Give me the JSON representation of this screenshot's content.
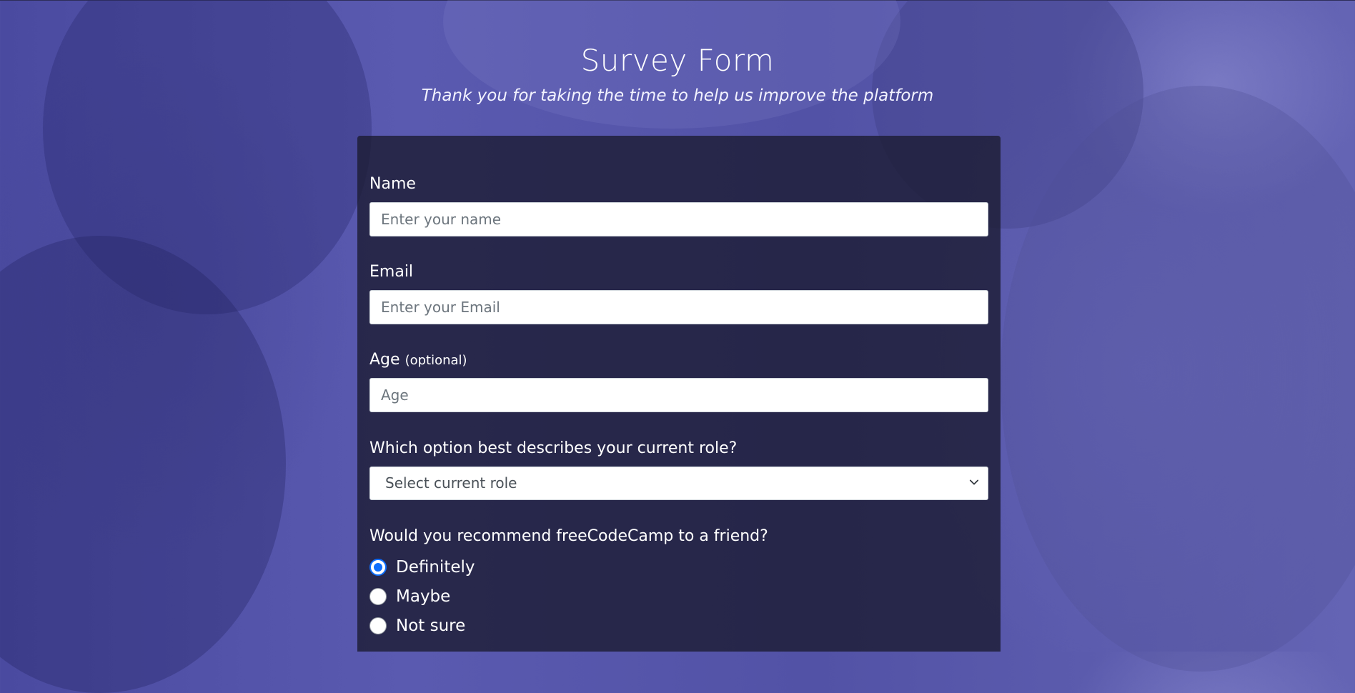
{
  "header": {
    "title": "Survey Form",
    "subtitle": "Thank you for taking the time to help us improve the platform"
  },
  "form": {
    "name": {
      "label": "Name",
      "placeholder": "Enter your name",
      "value": ""
    },
    "email": {
      "label": "Email",
      "placeholder": "Enter your Email",
      "value": ""
    },
    "age": {
      "label": "Age",
      "label_note": "(optional)",
      "placeholder": "Age",
      "value": ""
    },
    "role": {
      "label": "Which option best describes your current role?",
      "selected": "Select current role"
    },
    "recommend": {
      "label": "Would you recommend freeCodeCamp to a friend?",
      "options": [
        {
          "label": "Definitely",
          "checked": true
        },
        {
          "label": "Maybe",
          "checked": false
        },
        {
          "label": "Not sure",
          "checked": false
        }
      ]
    }
  },
  "colors": {
    "background": "#5555aa",
    "card": "#1b1b32",
    "radio_accent": "#0d6efd",
    "text": "#ffffff"
  },
  "icons": {
    "select_chevron": "chevron-down-icon",
    "radio_checked": "radio-checked-icon",
    "radio_unchecked": "radio-unchecked-icon"
  }
}
